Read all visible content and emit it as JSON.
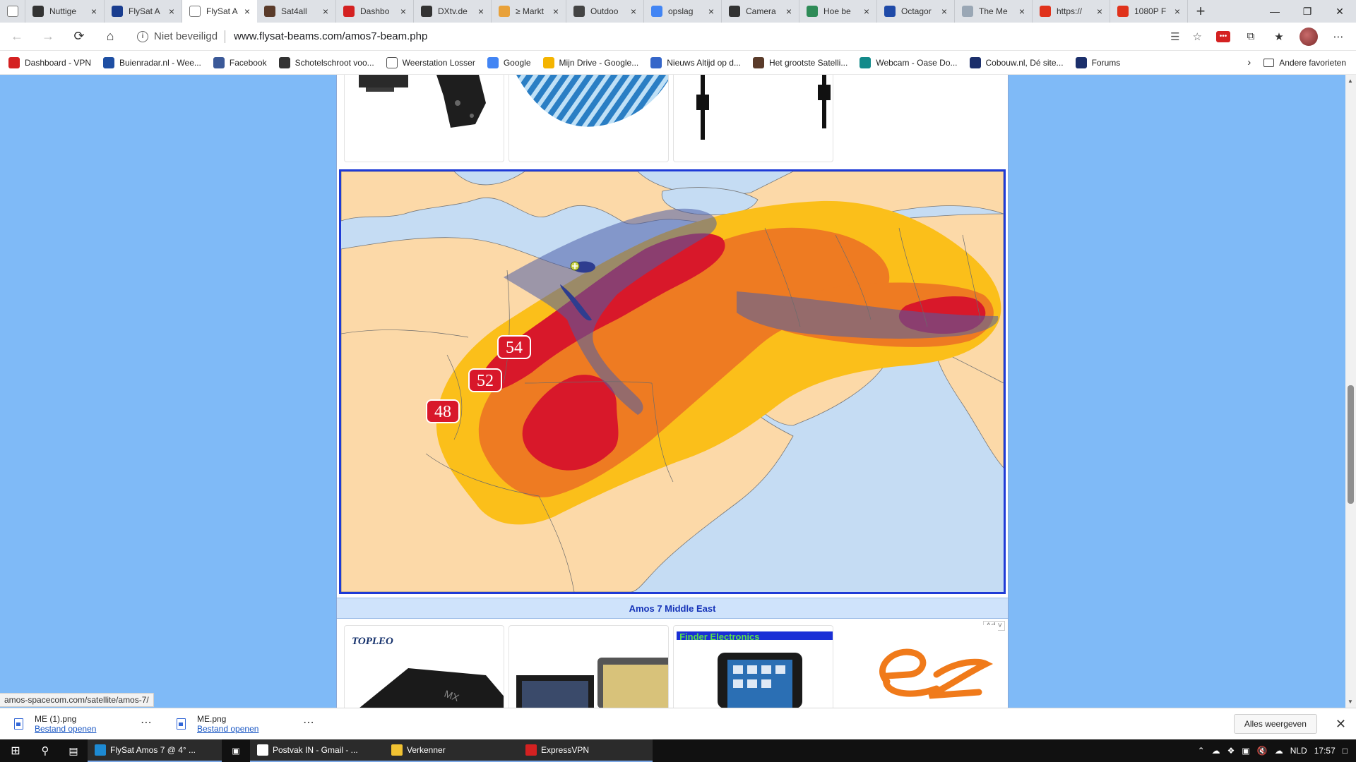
{
  "tabs": [
    {
      "title": "",
      "icon": "page-icon",
      "color": "#ffffff"
    },
    {
      "title": "Nuttige",
      "icon": "github-icon",
      "color": "#333333"
    },
    {
      "title": "FlySat A",
      "icon": "flysat-icon",
      "color": "#1a3d8f"
    },
    {
      "title": "FlySat A",
      "icon": "page-icon",
      "color": "#ffffff",
      "active": true
    },
    {
      "title": "Sat4all",
      "icon": "sat4all-icon",
      "color": "#5a3b2a"
    },
    {
      "title": "Dashbo",
      "icon": "vpn-icon",
      "color": "#d42121"
    },
    {
      "title": "DXtv.de",
      "icon": "dxtv-icon",
      "color": "#333333"
    },
    {
      "title": "≥ Markt",
      "icon": "marktplaats-icon",
      "color": "#e8a13a"
    },
    {
      "title": "Outdoo",
      "icon": "outdoor-icon",
      "color": "#444444"
    },
    {
      "title": "opslag",
      "icon": "google-icon",
      "color": "#4285f4"
    },
    {
      "title": "Camera",
      "icon": "camera-icon",
      "color": "#333333"
    },
    {
      "title": "Hoe be",
      "icon": "ep-icon",
      "color": "#2e8b57"
    },
    {
      "title": "Octagor",
      "icon": "octagon-icon",
      "color": "#1f4aa8"
    },
    {
      "title": "The Me",
      "icon": "globe-icon",
      "color": "#9aa7b5"
    },
    {
      "title": "https://",
      "icon": "red-box-icon",
      "color": "#e0321b"
    },
    {
      "title": "1080P F",
      "icon": "red-box-icon",
      "color": "#e0321b"
    }
  ],
  "address": {
    "security_label": "Niet beveiligd",
    "url": "www.flysat-beams.com/amos7-beam.php"
  },
  "bookmarks": [
    {
      "label": "Dashboard - VPN",
      "color": "#d42121"
    },
    {
      "label": "Buienradar.nl - Wee...",
      "color": "#1e4fa3"
    },
    {
      "label": "Facebook",
      "color": "#3b5998"
    },
    {
      "label": "Schotelschroot voo...",
      "color": "#333333"
    },
    {
      "label": "Weerstation Losser",
      "color": "#ffffff"
    },
    {
      "label": "Google",
      "color": "#4285f4"
    },
    {
      "label": "Mijn Drive - Google...",
      "color": "#f4b400"
    },
    {
      "label": "Nieuws  Altijd op d...",
      "color": "#3566c9"
    },
    {
      "label": "Het grootste Satelli...",
      "color": "#5a3b2a"
    },
    {
      "label": "Webcam - Oase Do...",
      "color": "#138a8a"
    },
    {
      "label": "Cobouw.nl, Dé site...",
      "color": "#1b2f6b"
    },
    {
      "label": "Forums",
      "color": "#1b2f6b"
    }
  ],
  "bookmarks_other": "Andere favorieten",
  "map": {
    "caption": "Amos 7 Middle East",
    "contour_labels": [
      "54",
      "52",
      "48"
    ],
    "colors": {
      "sea": "#c5dcf3",
      "land": "#fcd9a8",
      "contour_yellow": "#fbbf1a",
      "contour_orange": "#ee7b22",
      "contour_red": "#d8182a",
      "beam_overlay": "#5a6bb0"
    }
  },
  "ad_badge": "Ad",
  "ads_bottom": [
    {
      "brand": "TOPLEO"
    },
    {
      "brand": ""
    },
    {
      "brand": "Finder Electronics"
    },
    {
      "brand": ""
    }
  ],
  "status_url": "amos-spacecom.com/satellite/amos-7/",
  "downloads": [
    {
      "name": "ME (1).png",
      "action": "Bestand openen"
    },
    {
      "name": "ME.png",
      "action": "Bestand openen"
    }
  ],
  "downloads_show_all": "Alles weergeven",
  "taskbar": {
    "items": [
      {
        "label": "FlySat Amos 7 @ 4° ...",
        "wide": true,
        "color": "#1d8ad3"
      },
      {
        "label": "Postvak IN - Gmail - ...",
        "wide": true,
        "color": "#ffffff"
      },
      {
        "label": "Verkenner",
        "wide": true,
        "color": "#f1c232"
      },
      {
        "label": "ExpressVPN",
        "wide": true,
        "color": "#d42121"
      }
    ],
    "lang": "NLD",
    "time": "17:57"
  }
}
